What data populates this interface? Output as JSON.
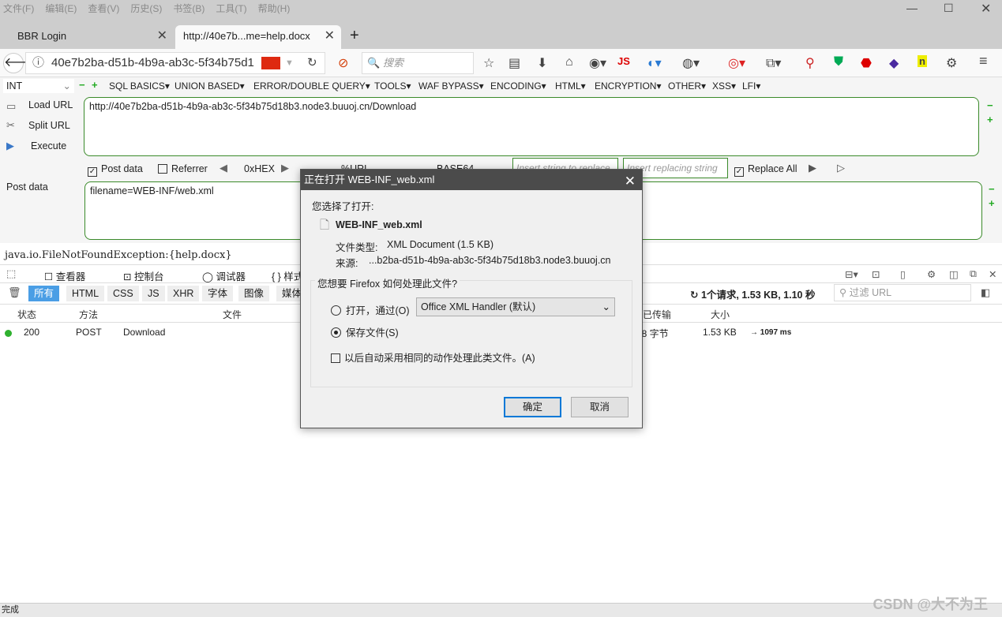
{
  "menubar": [
    "文件(F)",
    "编辑(E)",
    "查看(V)",
    "历史(S)",
    "书签(B)",
    "工具(T)",
    "帮助(H)"
  ],
  "tabs": [
    {
      "label": "BBR Login"
    },
    {
      "label": "http://40e7b...me=help.docx"
    }
  ],
  "nav": {
    "url": "40e7b2ba-d51b-4b9a-ab3c-5f34b75d1",
    "search_placeholder": "搜索",
    "js_label": "JS"
  },
  "hackbar": {
    "select": "INT",
    "menus": [
      "SQL BASICS▾",
      "UNION BASED▾",
      "ERROR/DOUBLE QUERY▾",
      "TOOLS▾",
      "WAF BYPASS▾",
      "ENCODING▾",
      "HTML▾",
      "ENCRYPTION▾",
      "OTHER▾",
      "XSS▾",
      "LFI▾"
    ],
    "load_url": "Load URL",
    "split_url": "Split URL",
    "execute": "Execute",
    "url_value": "http://40e7b2ba-d51b-4b9a-ab3c-5f34b75d18b3.node3.buuoj.cn/Download",
    "post_data_check": "Post data",
    "post_data_checked": true,
    "referrer_check": "Referrer",
    "referrer_checked": false,
    "hex": "0xHEX",
    "urlenc": "%URL",
    "base64": "BASE64",
    "replace_placeholder": "Insert string to replace",
    "replacing_placeholder": "Insert replacing string",
    "replace_all": "Replace All",
    "replace_all_checked": true,
    "post_label": "Post data",
    "post_value": "filename=WEB-INF/web.xml"
  },
  "page_text": "java.io.FileNotFoundException:{help.docx}",
  "devtools": {
    "tabs": [
      "查看器",
      "控制台",
      "调试器",
      "{ } 样式"
    ],
    "filters": [
      "所有",
      "HTML",
      "CSS",
      "JS",
      "XHR",
      "字体",
      "图像",
      "媒体"
    ],
    "summary": "1个请求, 1.53 KB, 1.10 秒",
    "filter_placeholder": "过滤 URL",
    "columns": [
      "状态",
      "方法",
      "文件",
      "已传输",
      "大小"
    ],
    "rows": [
      {
        "status": "200",
        "method": "POST",
        "file": "Download",
        "transferred": "98 字节",
        "size": "1.53 KB",
        "timing": "→ 1097 ms"
      }
    ]
  },
  "dialog": {
    "title": "正在打开 WEB-INF_web.xml",
    "chosen": "您选择了打开:",
    "filename": "WEB-INF_web.xml",
    "type_label": "文件类型:",
    "type_value": "XML Document (1.5 KB)",
    "source_label": "来源:",
    "source_value": "...b2ba-d51b-4b9a-ab3c-5f34b75d18b3.node3.buuoj.cn",
    "question": "您想要 Firefox 如何处理此文件?",
    "open_with": "打开，通过(O)",
    "open_app": "Office XML Handler (默认)",
    "save": "保存文件(S)",
    "selected": "save",
    "remember": "以后自动采用相同的动作处理此类文件。(A)",
    "ok": "确定",
    "cancel": "取消"
  },
  "status": "完成",
  "watermark": "CSDN @大不为王"
}
